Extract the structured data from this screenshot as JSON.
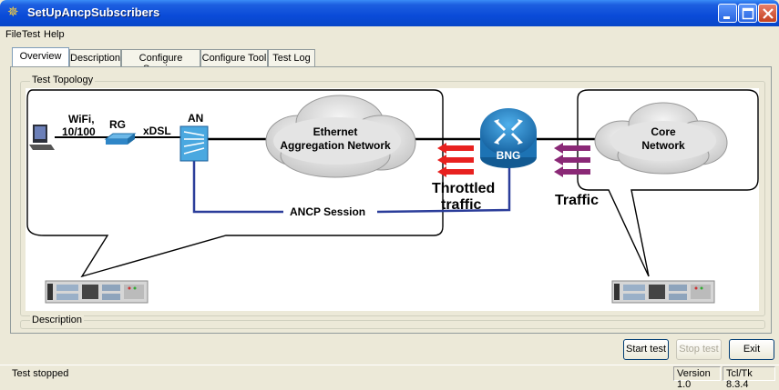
{
  "window": {
    "title": "SetUpAncpSubscribers",
    "controls": [
      "minimize-icon",
      "maximize-icon",
      "close-icon"
    ]
  },
  "menu": {
    "items": [
      "File",
      "Test",
      "Help"
    ]
  },
  "tabs": [
    {
      "label": "Overview",
      "active": true
    },
    {
      "label": "Description",
      "active": false
    },
    {
      "label": "Configure Session",
      "active": false
    },
    {
      "label": "Configure Tool",
      "active": false
    },
    {
      "label": "Test Log",
      "active": false
    }
  ],
  "topology": {
    "group_label": "Test Topology",
    "labels": {
      "wifi": "WiFi,",
      "speed": "10/100",
      "rg": "RG",
      "xdsl": "xDSL",
      "an": "AN",
      "eth_line1": "Ethernet",
      "eth_line2": "Aggregation Network",
      "bng": "BNG",
      "core_line1": "Core",
      "core_line2": "Network",
      "ancp": "ANCP Session",
      "throttled_line1": "Throttled",
      "throttled_line2": "traffic",
      "traffic": "Traffic"
    },
    "colors": {
      "throttled_arrows": "#e8211f",
      "traffic_arrows": "#8a2876",
      "ancp_line": "#2b3d9a",
      "bng": "#1f7fc4"
    }
  },
  "description": {
    "group_label": "Description"
  },
  "buttons": {
    "start": "Start test",
    "stop": "Stop test",
    "exit": "Exit"
  },
  "status": {
    "text": "Test stopped",
    "version": "Version 1.0",
    "tcl": "Tcl/Tk 8.3.4"
  }
}
